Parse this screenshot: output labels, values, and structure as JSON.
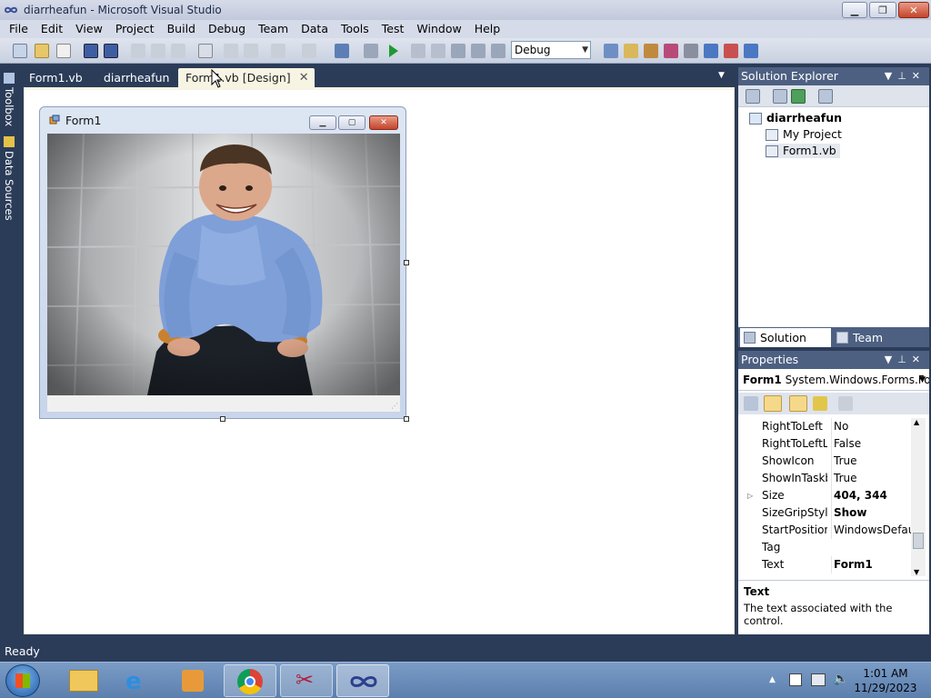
{
  "window": {
    "title": "diarrheafun - Microsoft Visual Studio"
  },
  "menu": [
    "File",
    "Edit",
    "View",
    "Project",
    "Build",
    "Debug",
    "Team",
    "Data",
    "Tools",
    "Test",
    "Window",
    "Help"
  ],
  "toolbar": {
    "configuration": "Debug"
  },
  "side_tabs": {
    "toolbox": "Toolbox",
    "data_sources": "Data Sources"
  },
  "doc_tabs": [
    {
      "label": "Form1.vb",
      "active": false
    },
    {
      "label": "diarrheafun",
      "active": false
    },
    {
      "label": "Form1.vb [Design]",
      "active": true
    }
  ],
  "form": {
    "title": "Form1"
  },
  "solution_explorer": {
    "title": "Solution Explorer",
    "project": "diarrheafun",
    "items": [
      "My Project",
      "Form1.vb"
    ],
    "tabs": [
      "Solution Ex...",
      "Team Explo..."
    ]
  },
  "properties": {
    "title": "Properties",
    "object": "Form1",
    "object_type": "System.Windows.Forms.Fo",
    "rows": [
      {
        "name": "RightToLeft",
        "value": "No",
        "bold": false
      },
      {
        "name": "RightToLeftLa",
        "value": "False",
        "bold": false
      },
      {
        "name": "ShowIcon",
        "value": "True",
        "bold": false
      },
      {
        "name": "ShowInTaskb",
        "value": "True",
        "bold": false
      },
      {
        "name": "Size",
        "value": "404, 344",
        "bold": true
      },
      {
        "name": "SizeGripStyle",
        "value": "Show",
        "bold": true
      },
      {
        "name": "StartPosition",
        "value": "WindowsDefault",
        "bold": false
      },
      {
        "name": "Tag",
        "value": "",
        "bold": false
      },
      {
        "name": "Text",
        "value": "Form1",
        "bold": true
      }
    ],
    "description_title": "Text",
    "description_text": "The text associated with the control."
  },
  "status": {
    "text": "Ready"
  },
  "clock": {
    "time": "1:01 AM",
    "date": "11/29/2023"
  },
  "colors": {
    "accent": "#4d6082",
    "background": "#2b3c59",
    "doc_tab": "#f7f4e4"
  }
}
